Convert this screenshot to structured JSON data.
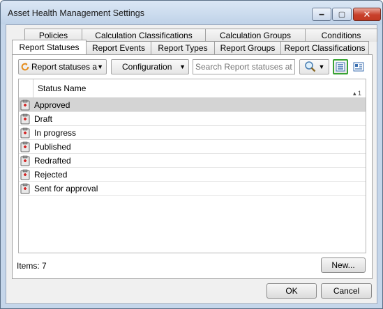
{
  "window": {
    "title": "Asset Health Management Settings",
    "controls": {
      "minimize": "▬",
      "maximize": "▢",
      "close": "✕"
    }
  },
  "tabs": {
    "row_back": [
      "Policies",
      "Calculation Classifications",
      "Calculation Groups",
      "Conditions"
    ],
    "row_front": [
      "Report Statuses",
      "Report Events",
      "Report Types",
      "Report Groups",
      "Report Classifications"
    ],
    "active": "Report Statuses"
  },
  "toolbar": {
    "view_combo": "Report statuses a",
    "configuration_label": "Configuration",
    "search_placeholder": "Search Report statuses at your",
    "icons": [
      "search-icon",
      "list-view-icon",
      "detail-view-icon"
    ]
  },
  "grid": {
    "column_header": "Status Name",
    "sort_indicator": "▴ 1",
    "rows": [
      "Approved",
      "Draft",
      "In progress",
      "Published",
      "Redrafted",
      "Rejected",
      "Sent for approval"
    ],
    "selected_row": 0
  },
  "footer": {
    "items_count": "Items: 7",
    "new_button": "New...",
    "ok_button": "OK",
    "cancel_button": "Cancel"
  },
  "colors": {
    "accent_green": "#3aa335",
    "selected_row_bg": "#d4d4d4",
    "close_red": "#c8402b"
  }
}
